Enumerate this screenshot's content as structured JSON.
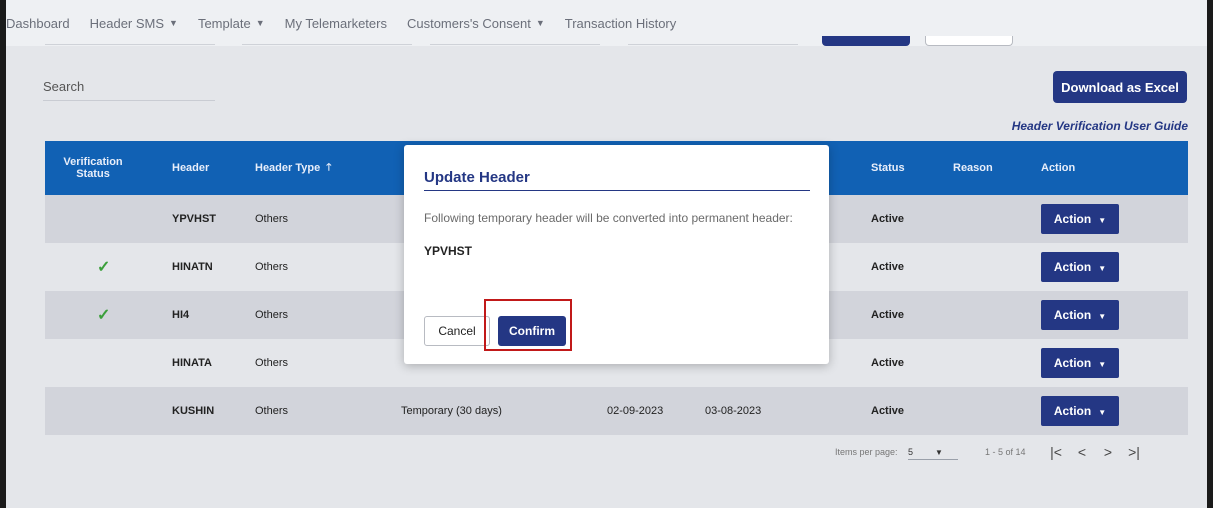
{
  "nav": {
    "items": [
      {
        "label": "Dashboard",
        "caret": false
      },
      {
        "label": "Header SMS",
        "caret": true
      },
      {
        "label": "Template",
        "caret": true
      },
      {
        "label": "My Telemarketers",
        "caret": false
      },
      {
        "label": "Customers's Consent",
        "caret": true
      },
      {
        "label": "Transaction History",
        "caret": false
      }
    ]
  },
  "toolbar": {
    "search_placeholder": "Search",
    "download_label": "Download as Excel",
    "guide_link": "Header Verification User Guide"
  },
  "table": {
    "headers": {
      "verification_status": "Verification Status",
      "header": "Header",
      "header_type": "Header Type",
      "status": "Status",
      "reason": "Reason",
      "action": "Action"
    },
    "rows": [
      {
        "verified": false,
        "header": "YPVHST",
        "type": "Others",
        "category": "",
        "date1": "",
        "date2": "",
        "status": "Active",
        "reason": "",
        "action": "Action"
      },
      {
        "verified": true,
        "header": "HINATN",
        "type": "Others",
        "category": "",
        "date1": "",
        "date2": "",
        "status": "Active",
        "reason": "",
        "action": "Action"
      },
      {
        "verified": true,
        "header": "HI4",
        "type": "Others",
        "category": "",
        "date1": "",
        "date2": "",
        "status": "Active",
        "reason": "",
        "action": "Action"
      },
      {
        "verified": false,
        "header": "HINATA",
        "type": "Others",
        "category": "",
        "date1": "",
        "date2": "",
        "status": "Active",
        "reason": "",
        "action": "Action"
      },
      {
        "verified": false,
        "header": "KUSHIN",
        "type": "Others",
        "category": "Temporary (30 days)",
        "date1": "02-09-2023",
        "date2": "03-08-2023",
        "status": "Active",
        "reason": "",
        "action": "Action"
      }
    ]
  },
  "pagination": {
    "items_per_page_label": "Items per page:",
    "items_per_page_value": "5",
    "range": "1 - 5 of 14"
  },
  "modal": {
    "title": "Update Header",
    "message": "Following temporary header will be converted into permanent header:",
    "header_value": "YPVHST",
    "cancel_label": "Cancel",
    "confirm_label": "Confirm"
  },
  "colors": {
    "primary": "#243784",
    "table_header": "#1161b4",
    "check": "#3b9f3b",
    "highlight": "#c11919"
  }
}
